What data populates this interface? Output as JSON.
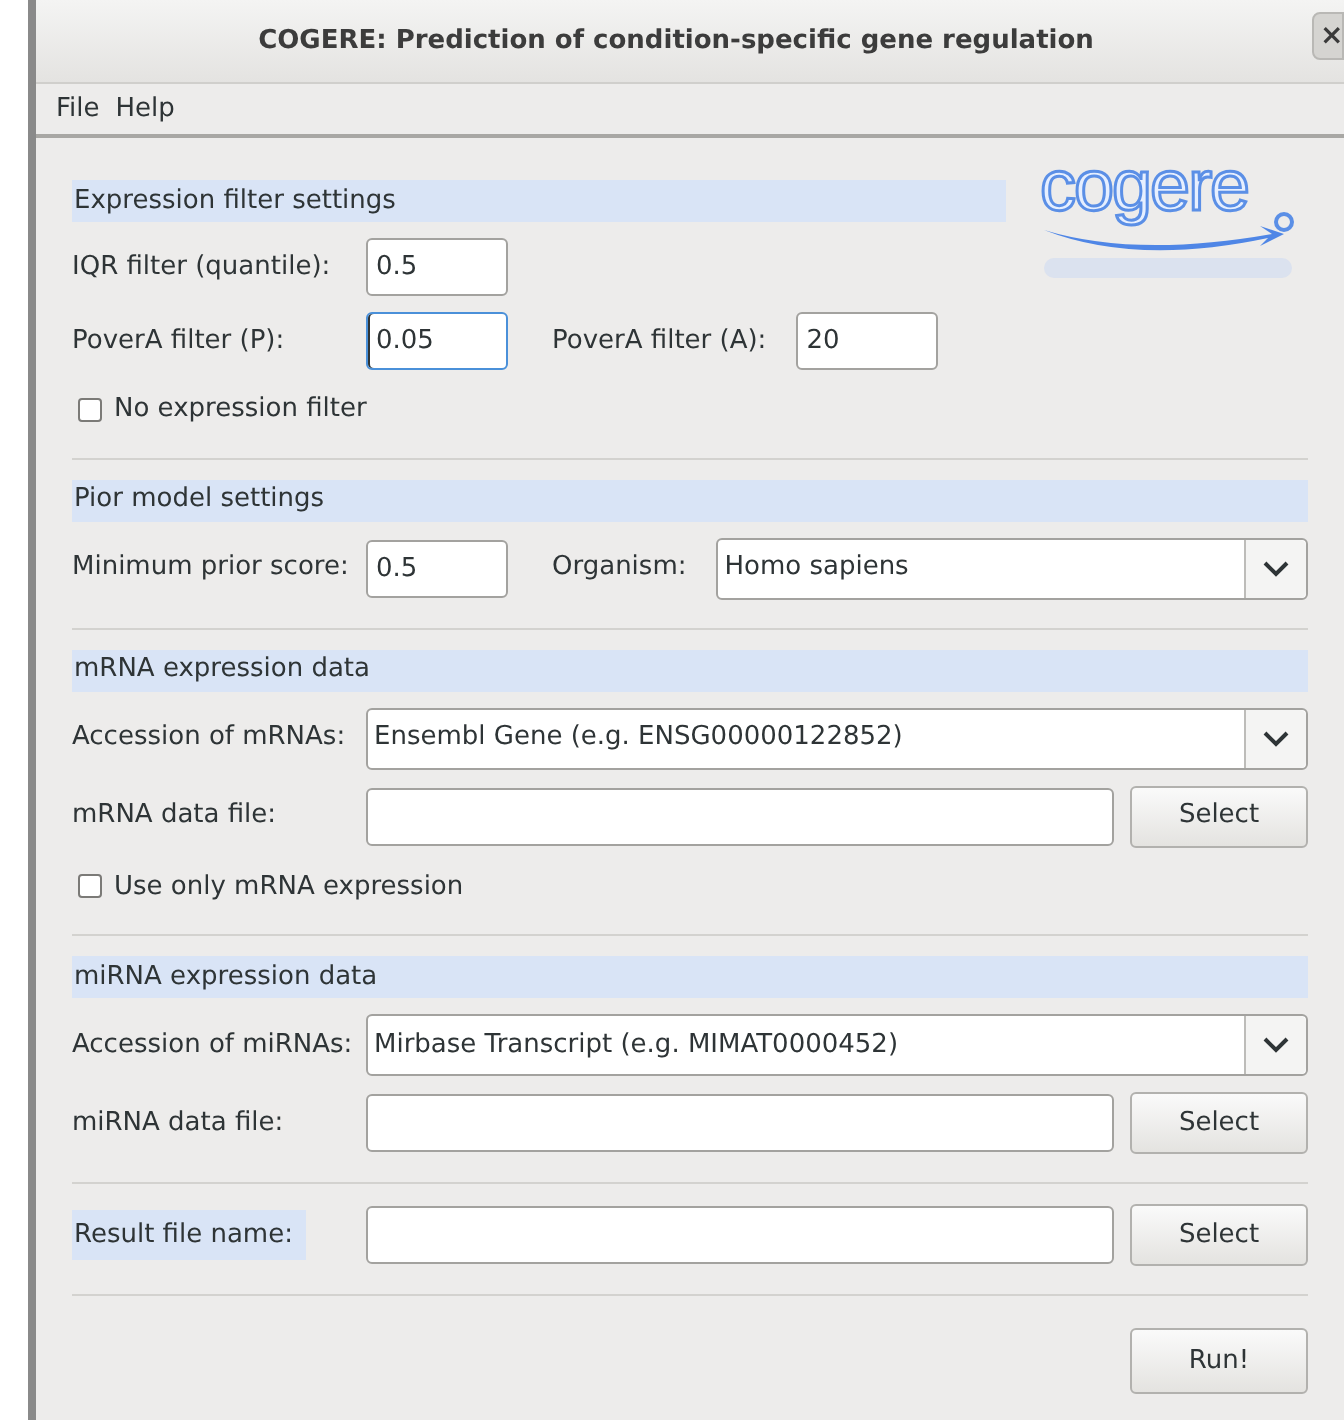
{
  "window": {
    "title": "COGERE: Prediction of condition-specific gene regulation",
    "close": "×"
  },
  "menu": [
    {
      "label": "File"
    },
    {
      "label": "Help"
    }
  ],
  "logo": {
    "text": "cogere"
  },
  "sections": [
    {
      "title": "Expression filter settings",
      "rows": [
        [
          {
            "kind": "label",
            "text": "IQR filter (quantile):"
          },
          {
            "kind": "number_field",
            "value": "0.5",
            "focused": false
          }
        ],
        [
          {
            "kind": "label",
            "text": "PoverA filter (P):"
          },
          {
            "kind": "number_field",
            "value": "0.05",
            "focused": true
          },
          {
            "kind": "inline_label",
            "text": "PoverA filter (A):"
          },
          {
            "kind": "number_field",
            "value": "20",
            "focused": false
          }
        ],
        [
          {
            "kind": "checkbox",
            "text": "No expression filter",
            "checked": false
          }
        ]
      ]
    },
    {
      "title": "Pior model settings",
      "rows": [
        [
          {
            "kind": "label",
            "text": "Minimum prior score:"
          },
          {
            "kind": "number_field",
            "value": "0.5",
            "focused": false
          },
          {
            "kind": "inline_label",
            "text": "Organism:"
          },
          {
            "kind": "combo",
            "value": "Homo sapiens"
          }
        ]
      ]
    },
    {
      "title": "mRNA expression data",
      "rows": [
        [
          {
            "kind": "label",
            "text": "Accession of mRNAs:"
          },
          {
            "kind": "combo",
            "value": "Ensembl Gene (e.g. ENSG00000122852)"
          }
        ],
        [
          {
            "kind": "label",
            "text": "mRNA data file:"
          },
          {
            "kind": "text_field",
            "focused": false
          },
          {
            "kind": "button",
            "text": "Select"
          }
        ],
        [
          {
            "kind": "checkbox",
            "text": "Use only mRNA expression",
            "checked": false
          }
        ]
      ]
    },
    {
      "title": "miRNA expression data",
      "rows": [
        [
          {
            "kind": "label",
            "text": "Accession of miRNAs:"
          },
          {
            "kind": "combo",
            "value": "Mirbase Transcript (e.g. MIMAT0000452)"
          }
        ],
        [
          {
            "kind": "label",
            "text": "miRNA data file:"
          },
          {
            "kind": "text_field",
            "focused": false
          },
          {
            "kind": "button",
            "text": "Select"
          }
        ]
      ]
    },
    {
      "rows": [
        [
          {
            "kind": "band_label",
            "text": "Result file name:"
          },
          {
            "kind": "text_field",
            "focused": false
          },
          {
            "kind": "button",
            "text": "Select"
          }
        ]
      ]
    },
    {
      "rows": [
        [
          {
            "kind": "button",
            "text": "Run!"
          }
        ]
      ]
    }
  ]
}
